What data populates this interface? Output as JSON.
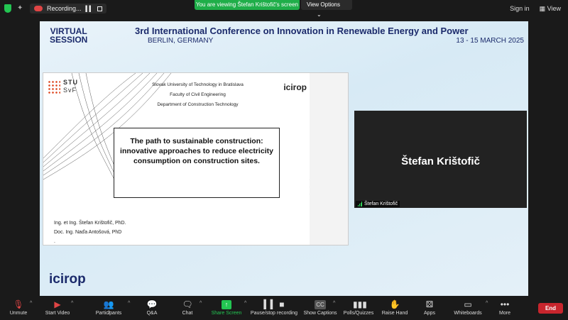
{
  "topbar": {
    "recording_label": "Recording...",
    "viewing_banner": "You are viewing Štefan Krištofič's screen",
    "view_options": "View Options",
    "sign_in": "Sign in",
    "view": "View"
  },
  "slide": {
    "virtual_line1": "VIRTUAL",
    "virtual_line2": "SESSION",
    "conference_title": "3rd International Conference on Innovation in Renewable Energy and Power",
    "conference_place": "BERLIN, GERMANY",
    "conference_date": "13 - 15 MARCH 2025",
    "footer_logo": "icirop",
    "inner": {
      "stu_line1": "STU",
      "stu_line2": "SvF",
      "university": "Slovak University of Technology in Bratislava",
      "faculty": "Faculty of Civil Engineering",
      "department": "Department of Construction Technology",
      "logo": "icirop",
      "title": "The path to sustainable construction: innovative approaches to reduce electricity consumption on construction sites.",
      "author1": "Ing. et Ing. Štefan Krištofič, PhD.",
      "author2": "Doc. Ing. Naďa Antošová, PhD",
      "author3": "."
    }
  },
  "participant": {
    "name": "Štefan Krištofič",
    "tag": "Štefan Krištofič"
  },
  "toolbar": {
    "unmute": "Unmute",
    "start_video": "Start Video",
    "participants": "Participants",
    "participants_count": "7",
    "qa": "Q&A",
    "chat": "Chat",
    "share_screen": "Share Screen",
    "pause_recording": "Pause/stop recording",
    "show_captions": "Show Captions",
    "polls": "Polls/Quizzes",
    "raise_hand": "Raise Hand",
    "apps": "Apps",
    "whiteboards": "Whiteboards",
    "more": "More",
    "end": "End"
  },
  "colors": {
    "accent_green": "#1fae49",
    "end_red": "#c8252d",
    "conference_navy": "#1b2a6b"
  }
}
